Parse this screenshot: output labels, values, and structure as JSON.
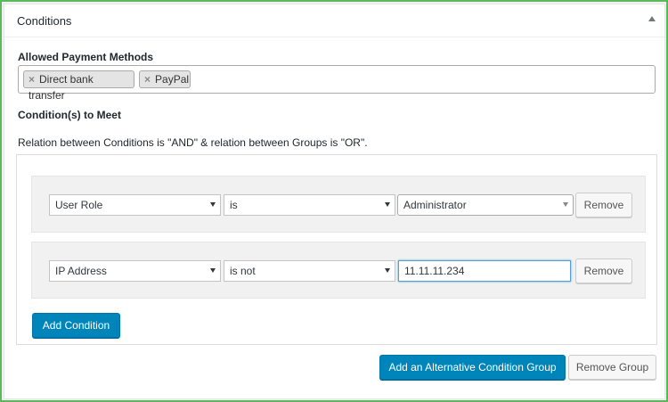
{
  "panel": {
    "title": "Conditions"
  },
  "payment": {
    "label": "Allowed Payment Methods",
    "tags": [
      {
        "label": "Direct bank transfer",
        "remove": "×"
      },
      {
        "label": "PayPal",
        "remove": "×"
      }
    ]
  },
  "conditions": {
    "label": "Condition(s) to Meet",
    "description": "Relation between Conditions is \"AND\" & relation between Groups is \"OR\".",
    "rows": [
      {
        "field": "User Role",
        "operator": "is",
        "value": "Administrator",
        "remove_label": "Remove"
      },
      {
        "field": "IP Address",
        "operator": "is not",
        "value": "11.11.11.234",
        "remove_label": "Remove"
      }
    ],
    "add_condition_label": "Add Condition"
  },
  "footer": {
    "add_group_label": "Add an Alternative Condition Group",
    "remove_group_label": "Remove Group"
  },
  "colors": {
    "primary": "#0085ba",
    "frame": "#5cb85c"
  }
}
